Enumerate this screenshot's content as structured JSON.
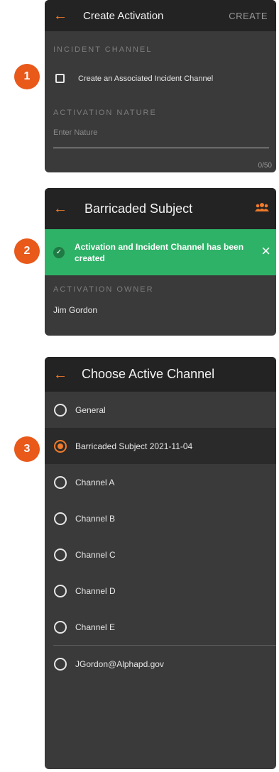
{
  "steps": [
    "1",
    "2",
    "3"
  ],
  "screen1": {
    "title": "Create Activation",
    "action": "CREATE",
    "incident_section": "INCIDENT CHANNEL",
    "checkbox_label": "Create an Associated Incident Channel",
    "nature_section": "ACTIVATION NATURE",
    "nature_placeholder": "Enter Nature",
    "counter": "0/50"
  },
  "screen2": {
    "title": "Barricaded Subject",
    "toast_message": "Activation and Incident Channel has been created",
    "owner_section": "ACTIVATION OWNER",
    "owner_name": "Jim Gordon"
  },
  "screen3": {
    "title": "Choose Active Channel",
    "channels": [
      {
        "label": "General",
        "selected": false
      },
      {
        "label": "Barricaded Subject 2021-11-04",
        "selected": true
      },
      {
        "label": "Channel A",
        "selected": false
      },
      {
        "label": "Channel B",
        "selected": false
      },
      {
        "label": "Channel C",
        "selected": false
      },
      {
        "label": "Channel D",
        "selected": false
      },
      {
        "label": "Channel E",
        "selected": false
      },
      {
        "label": "JGordon@Alphapd.gov",
        "selected": false
      }
    ]
  },
  "colors": {
    "accent": "#f07b2b",
    "badge": "#e8591a",
    "success": "#2eb267",
    "panel_bg": "#3a3a3a",
    "appbar_bg": "#232323"
  },
  "icons": [
    "back-arrow-icon",
    "group-icon",
    "check-circle-icon",
    "close-icon"
  ]
}
